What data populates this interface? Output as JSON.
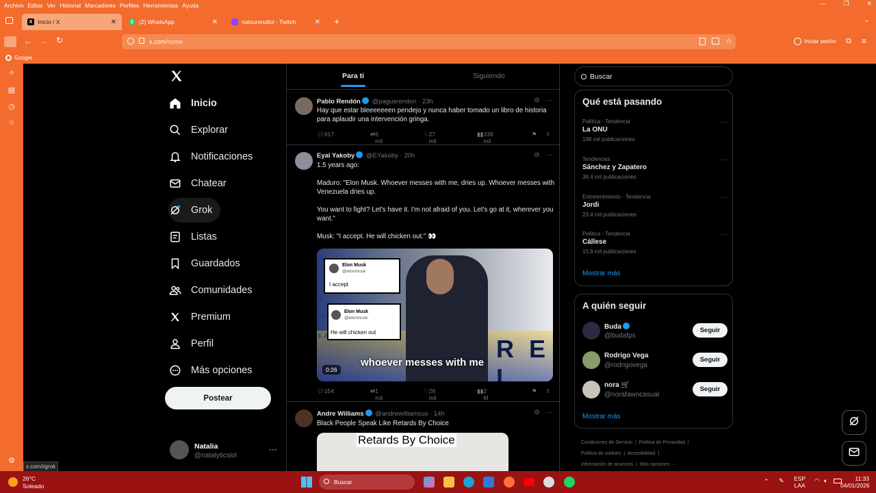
{
  "menubar": [
    "Archivo",
    "Editar",
    "Ver",
    "Historial",
    "Marcadores",
    "Perfiles",
    "Herramientas",
    "Ayuda"
  ],
  "tabs": [
    {
      "label": "Inicio / X",
      "favicon": "X"
    },
    {
      "label": "(2) WhatsApp",
      "favicon": "2"
    },
    {
      "label": "natsunexdlol - Twitch",
      "favicon": ""
    }
  ],
  "url": {
    "host": "x.com",
    "path": "/home"
  },
  "signin": "Iniciar sesión",
  "bookmark": "Google",
  "nav": {
    "items": [
      "Inicio",
      "Explorar",
      "Notificaciones",
      "Chatear",
      "Grok",
      "Listas",
      "Guardados",
      "Comunidades",
      "Premium",
      "Perfil",
      "Más opciones"
    ],
    "post": "Postear"
  },
  "profile": {
    "name": "Natalia",
    "handle": "@natalyticslol"
  },
  "status_url": "x.com/i/grok",
  "feed": {
    "tabs": [
      "Para ti",
      "Siguiendo"
    ],
    "tweets": [
      {
        "name": "Pablo Rendón",
        "handle": "@pagusrendon · 23h",
        "text": "Hay que estar bleeeeeeen pendejo y nunca haber tomado un libro de historia para aplaudir una intervención gringa.",
        "replies": "917",
        "reposts": "6 mil",
        "likes": "27 mil",
        "views": "338 mil"
      },
      {
        "name": "Eyal Yakoby",
        "handle": "@EYakoby · 20h",
        "text": "1.5 years ago:\n\nMaduro: \"Elon Musk. Whoever messes with me, dries up. Whoever messes with Venezuela dries up.\n\nYou want to fight? Let's have it. I'm not afraid of you. Let's go at it, wherever you want.\"\n\nMusk: \"I accept. He will chicken out.\" 👀",
        "video": {
          "card1_name": "Elon Musk",
          "card1_handle": "@elonmusk",
          "card1_text": "I accept",
          "card2_name": "Elon Musk",
          "card2_handle": "@elonmusk",
          "card2_text": "He will chicken out",
          "caption": "whoever messes with me",
          "duration": "0:26",
          "bg_letters": "R E L",
          "side_text": "24\nE\nE\nDENCIAL\nE JULIO"
        },
        "replies": "154",
        "reposts": "1 mil",
        "likes": "26 mil",
        "views": "2 M"
      },
      {
        "name": "Andre Williams",
        "handle": "@andrewilliamsus · 14h",
        "text": "Black People Speak Like Retards By Choice",
        "media_caption": "Retards By Choice"
      }
    ]
  },
  "search": {
    "placeholder": "Buscar"
  },
  "trends": {
    "title": "Qué está pasando",
    "items": [
      {
        "context": "Política · Tendencia",
        "title": "La ONU",
        "count": "198 mil publicaciones"
      },
      {
        "context": "Tendencias",
        "title": "Sánchez y Zapatero",
        "count": "36,4 mil publicaciones"
      },
      {
        "context": "Entretenimiento · Tendencia",
        "title": "Jordi",
        "count": "23,4 mil publicaciones"
      },
      {
        "context": "Política · Tendencia",
        "title": "Cállese",
        "count": "15,9 mil publicaciones"
      }
    ],
    "show_more": "Mostrar más"
  },
  "who_to_follow": {
    "title": "A quién seguir",
    "items": [
      {
        "name": "Buda",
        "handle": "@budafps",
        "button": "Seguir"
      },
      {
        "name": "Rodrigo Vega",
        "handle": "@rodrigovega",
        "button": "Seguir"
      },
      {
        "name": "nora 🛒",
        "handle": "@norafawncasual",
        "button": "Seguir"
      }
    ],
    "show_more": "Mostrar más"
  },
  "footer": {
    "line1a": "Condiciones de Servicio",
    "line1b": "Política de Privacidad",
    "line2a": "Política de cookies",
    "line2b": "Accesibilidad",
    "line3a": "Información de anuncios",
    "line3b": "Más opciones ···"
  },
  "taskbar": {
    "weather_temp": "26°C",
    "weather_desc": "Soleado",
    "search": "Buscar",
    "lang1": "ESP",
    "lang2": "LAA",
    "time": "11:33",
    "date": "04/01/2026"
  },
  "colors": {
    "accent": "#1d9bf0",
    "browser": "#f36b2d",
    "taskbar": "#9b1212"
  }
}
